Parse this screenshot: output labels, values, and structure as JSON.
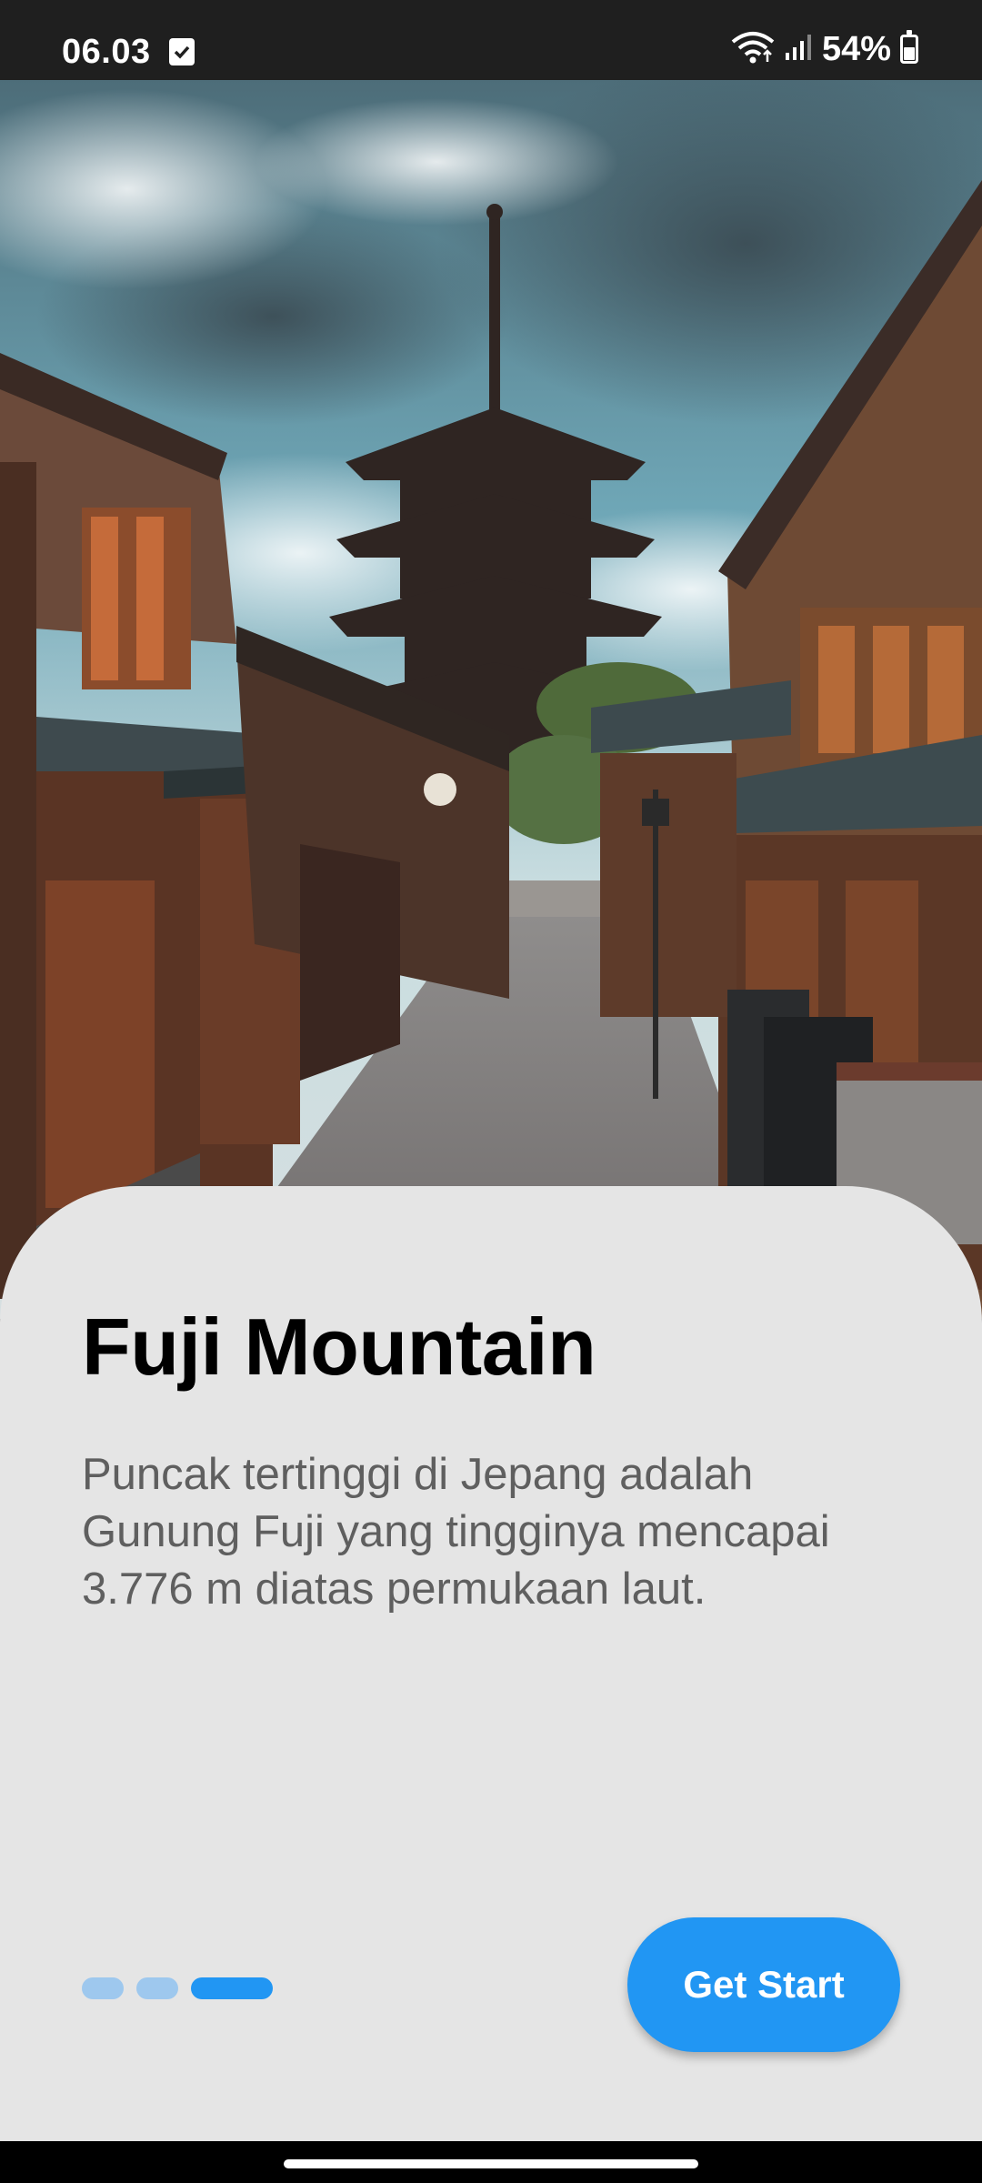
{
  "status_bar": {
    "time": "06.03",
    "battery": "54%",
    "icons": [
      "check-notification-icon",
      "wifi-icon",
      "signal-icon",
      "battery-icon"
    ]
  },
  "hero": {
    "image": "kyoto-street-pagoda-photo"
  },
  "onboarding": {
    "title": "Fuji Mountain",
    "description": "Puncak tertinggi di Jepang adalah Gunung Fuji yang tingginya mencapai 3.776 m diatas permukaan laut.",
    "page_indicator": {
      "total": 3,
      "active": 3
    },
    "cta_label": "Get Start"
  },
  "colors": {
    "accent": "#2196f3",
    "indicator_inactive": "#9ec8ee",
    "card_background": "#e5e5e5",
    "description_text": "#5f5f5f"
  }
}
